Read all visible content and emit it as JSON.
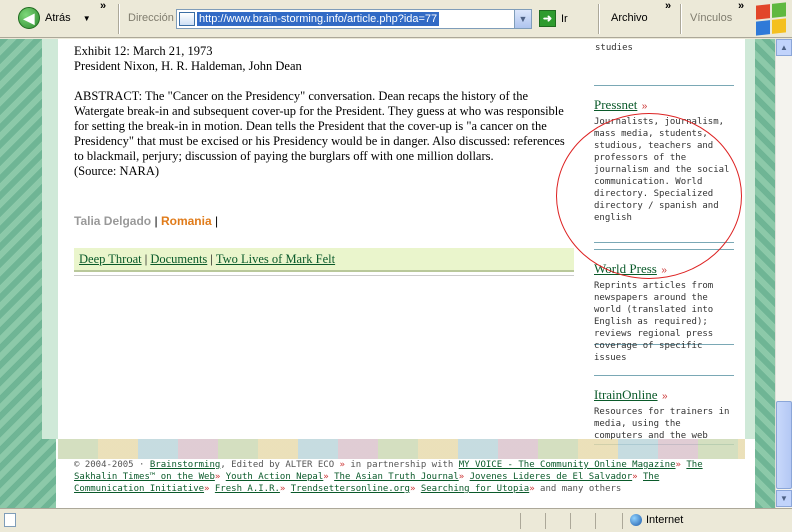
{
  "toolbar": {
    "back_label": "Atrás",
    "address_label": "Dirección",
    "url": "http://www.brain-storming.info/article.php?ida=77",
    "go_label": "Ir",
    "file_menu": "Archivo",
    "links_label": "Vínculos"
  },
  "article": {
    "exhibit": "Exhibit 12: March 21, 1973",
    "participants": "President Nixon, H. R. Haldeman, John Dean",
    "abstract": "ABSTRACT: The \"Cancer on the Presidency\" conversation. Dean recaps the history of the Watergate break-in and subsequent cover-up for the President. They guess at who was responsible for setting the break-in in motion. Dean tells the President that the cover-up is \"a cancer on the Presidency\" that must be excised or his Presidency would be in danger. Also discussed: references to blackmail, perjury; discussion of paying the burglars off with one million dollars.",
    "source": "(Source: NARA)",
    "author": "Talia Delgado",
    "country": "Romania"
  },
  "links": [
    "Deep Throat",
    "Documents",
    "Two Lives of Mark Felt"
  ],
  "sidebar": {
    "prev_fragment": "studies",
    "items": [
      {
        "title": "Pressnet",
        "desc": "Journalists, journalism, mass media, students, studious, teachers and professors of the journalism and the social communication. World directory. Specialized directory / spanish and english"
      },
      {
        "title": "World Press",
        "desc": "Reprints articles from newspapers around the world (translated into English as required); reviews regional press coverage of specific issues"
      },
      {
        "title": "ItrainOnline",
        "desc": "Resources for trainers in media, using the computers and the web"
      }
    ]
  },
  "footer": {
    "copyright": "© 2004-2005 ·",
    "brainstorming": "Brainstorming",
    "edited_by": ", Edited by ALTER ECO",
    "partnership": "in partnership with",
    "partners": [
      "MY VOICE - The Community Online Magazine",
      "The Sakhalin Times™ on the Web",
      "Youth Action Nepal",
      "The Asian Truth Journal",
      "Jovenes Lideres de El Salvador",
      "The Communication Initiative",
      "Fresh A.I.R.",
      "Trendsettersonline.org",
      "Searching for Utopia"
    ],
    "others": "and many others"
  },
  "status": {
    "zone": "Internet"
  },
  "colors": {
    "link_green": "#0a5a2a",
    "accent_orange": "#e07b1a",
    "circle_red": "#d22222",
    "linkbar_bg": "#eaf5cc"
  }
}
